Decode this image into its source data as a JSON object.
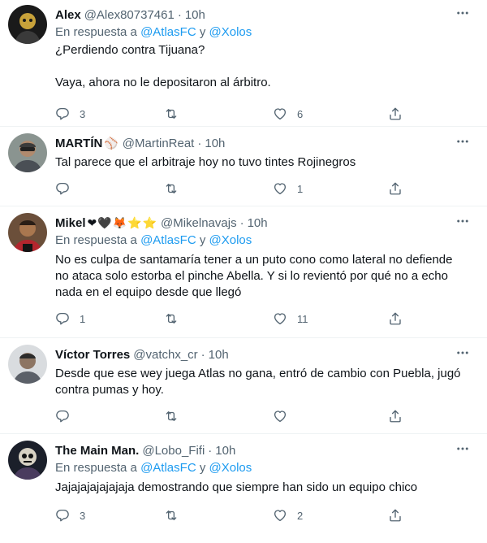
{
  "tweets": [
    {
      "name": "Alex",
      "handle": "@Alex80737461",
      "time": "10h",
      "reply_prefix": "En respuesta a",
      "reply_users": [
        "@AtlasFC",
        "@Xolos"
      ],
      "reply_conj": "y",
      "text_lines": [
        "¿Perdiendo contra Tijuana?",
        "Vaya, ahora no le depositaron al árbitro."
      ],
      "replies": "3",
      "retweets": "",
      "likes": "6"
    },
    {
      "name": "MARTÍN",
      "name_emoji": "⚾",
      "handle": "@MartinReat",
      "time": "10h",
      "text_lines": [
        "Tal parece que el arbitraje hoy no tuvo tintes Rojinegros"
      ],
      "replies": "",
      "retweets": "",
      "likes": "1"
    },
    {
      "name": "Mikel",
      "name_emoji": "❤🖤🦊⭐⭐",
      "handle": "@Mikelnavajs",
      "time": "10h",
      "reply_prefix": "En respuesta a",
      "reply_users": [
        "@AtlasFC",
        "@Xolos"
      ],
      "reply_conj": "y",
      "text_lines": [
        "No es culpa de santamaría tener a un puto cono como lateral no defiende",
        "no ataca solo estorba el pinche Abella. Y si lo revientó por qué no a echo",
        "nada en el equipo desde que llegó"
      ],
      "replies": "1",
      "retweets": "",
      "likes": "11"
    },
    {
      "name": "Víctor Torres",
      "handle": "@vatchx_cr",
      "time": "10h",
      "text_lines": [
        "Desde que ese wey juega Atlas no gana, entró de cambio con Puebla, jugó",
        "contra pumas y hoy."
      ],
      "replies": "",
      "retweets": "",
      "likes": ""
    },
    {
      "name": "The Main Man.",
      "handle": "@Lobo_Fifi",
      "time": "10h",
      "reply_prefix": "En respuesta a",
      "reply_users": [
        "@AtlasFC",
        "@Xolos"
      ],
      "reply_conj": "y",
      "text_lines": [
        "Jajajajajajajaja demostrando que siempre han sido un equipo chico"
      ],
      "replies": "3",
      "retweets": "",
      "likes": "2"
    }
  ],
  "icons": {
    "more": "more-icon",
    "reply": "reply-icon",
    "retweet": "retweet-icon",
    "like": "like-icon",
    "share": "share-icon"
  },
  "colors": {
    "link": "#1d9bf0",
    "secondary_text": "#536471",
    "primary_text": "#0f1419",
    "divider": "#eff3f4"
  }
}
